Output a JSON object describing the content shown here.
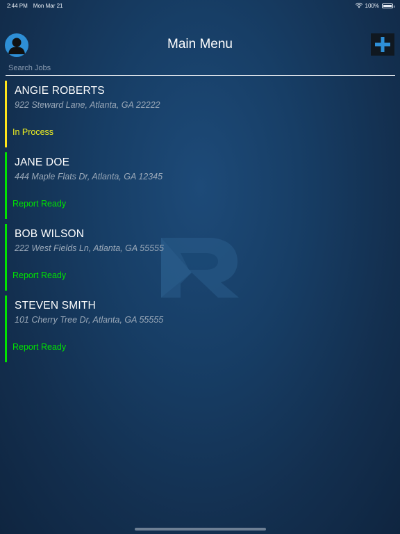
{
  "status_bar": {
    "time": "2:44 PM",
    "date": "Mon Mar 21",
    "battery": "100%"
  },
  "header": {
    "title": "Main Menu"
  },
  "search": {
    "placeholder": "Search Jobs"
  },
  "jobs": [
    {
      "name": "ANGIE ROBERTS",
      "address": "922 Steward Lane, Atlanta, GA 22222",
      "status": "In Process"
    },
    {
      "name": "JANE DOE",
      "address": "444 Maple Flats Dr, Atlanta, GA 12345",
      "status": "Report Ready"
    },
    {
      "name": "BOB WILSON",
      "address": "222 West Fields Ln, Atlanta, GA 55555",
      "status": "Report Ready"
    },
    {
      "name": "STEVEN SMITH",
      "address": "101 Cherry Tree Dr, Atlanta, GA 55555",
      "status": "Report Ready"
    }
  ],
  "colors": {
    "in_process": "#ffe51a",
    "report_ready": "#00e400",
    "accent": "#2e8fd6"
  },
  "icons": {
    "avatar": "user-avatar-icon",
    "add": "plus-icon",
    "logo": "r-logo-watermark"
  }
}
